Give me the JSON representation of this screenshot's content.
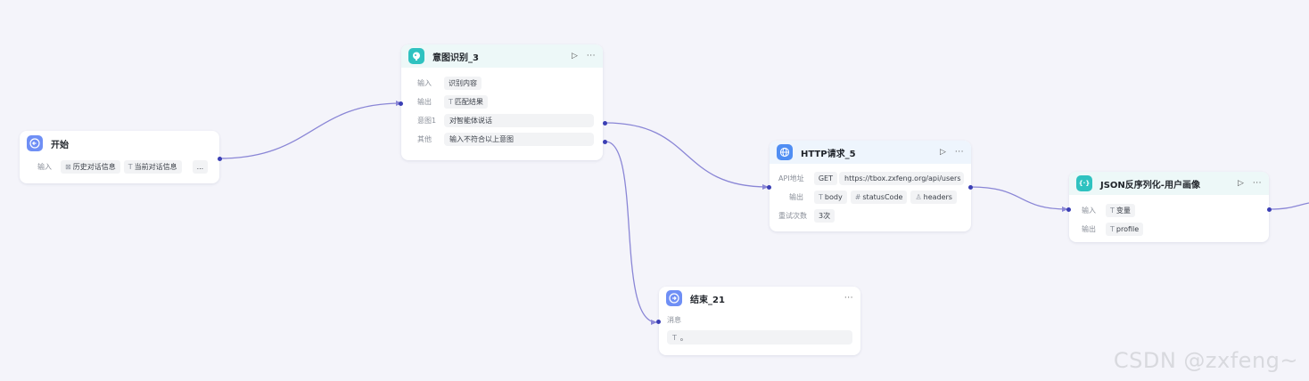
{
  "nodes": {
    "start": {
      "title": "开始",
      "input_label": "输入",
      "inputs": [
        {
          "type_icon": "⊠",
          "label": "历史对话信息"
        },
        {
          "type_icon": "T",
          "label": "当前对话信息"
        }
      ],
      "more": "..."
    },
    "intent": {
      "title": "意图识别_3",
      "run": "▷",
      "more": "···",
      "input_label": "输入",
      "input_value": "识别内容",
      "output_label": "输出",
      "output_type": "T",
      "output_value": "匹配结果",
      "intent1_label": "意图1",
      "intent1_value": "对智能体说话",
      "other_label": "其他",
      "other_value": "输入不符合以上意图"
    },
    "http": {
      "title": "HTTP请求_5",
      "run": "▷",
      "more": "···",
      "api_label": "API地址",
      "method": "GET",
      "url": "https://tbox.zxfeng.org/api/users",
      "output_label": "输出",
      "outputs": [
        {
          "type_icon": "T",
          "label": "body"
        },
        {
          "type_icon": "#",
          "label": "statusCode"
        },
        {
          "type_icon": "♙",
          "label": "headers"
        }
      ],
      "retry_label": "重试次数",
      "retry_value": "3次"
    },
    "json": {
      "title": "JSON反序列化-用户画像",
      "icon_text": "{·}",
      "run": "▷",
      "more": "···",
      "input_label": "输入",
      "input_type": "T",
      "input_value": "变量",
      "output_label": "输出",
      "output_type": "T",
      "output_value": "profile"
    },
    "end": {
      "title": "结束_21",
      "more": "···",
      "message_label": "消息",
      "message_type": "T",
      "message_value": "。"
    }
  },
  "watermark": "CSDN @zxfeng~",
  "colors": {
    "background": "#f4f4fa",
    "edge": "#8a86d6",
    "port": "#3b3fb5",
    "start_icon": "#6f8ff5",
    "intent_icon": "#2fc2c0",
    "http_icon": "#4f8ef3",
    "json_icon": "#2fc2c0",
    "end_icon": "#6f8ff5"
  }
}
